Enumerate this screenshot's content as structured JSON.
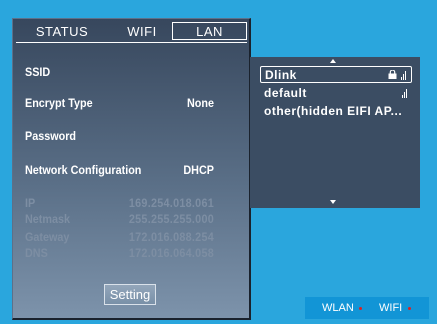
{
  "tabs": [
    {
      "label": "STATUS"
    },
    {
      "label": "WIFI"
    },
    {
      "label": "LAN"
    }
  ],
  "config": {
    "ssid_label": "SSID",
    "encrypt_label": "Encrypt Type",
    "encrypt_value": "None",
    "password_label": "Password",
    "netconf_label": "Network Configuration",
    "netconf_value": "DHCP",
    "ip_label": "IP",
    "ip_value": "169.254.018.061",
    "netmask_label": "Netmask",
    "netmask_value": "255.255.255.000",
    "gateway_label": "Gateway",
    "gateway_value": "172.016.088.254",
    "dns_label": "DNS",
    "dns_value": "172.016.064.058"
  },
  "setting_button": "Setting",
  "networks": [
    {
      "name": "Dlink",
      "locked": true,
      "selected": true
    },
    {
      "name": "default",
      "locked": false,
      "selected": false
    },
    {
      "name": "other(hidden EIFI AP...",
      "locked": false,
      "selected": false
    }
  ],
  "status_bar": {
    "wlan": "WLAN",
    "wifi": "WIFI",
    "indicator_color": "#e02020"
  },
  "icons": {
    "scroll_up": "triangle-up-icon",
    "scroll_down": "triangle-down-icon",
    "lock": "lock-icon",
    "signal": "signal-icon"
  }
}
